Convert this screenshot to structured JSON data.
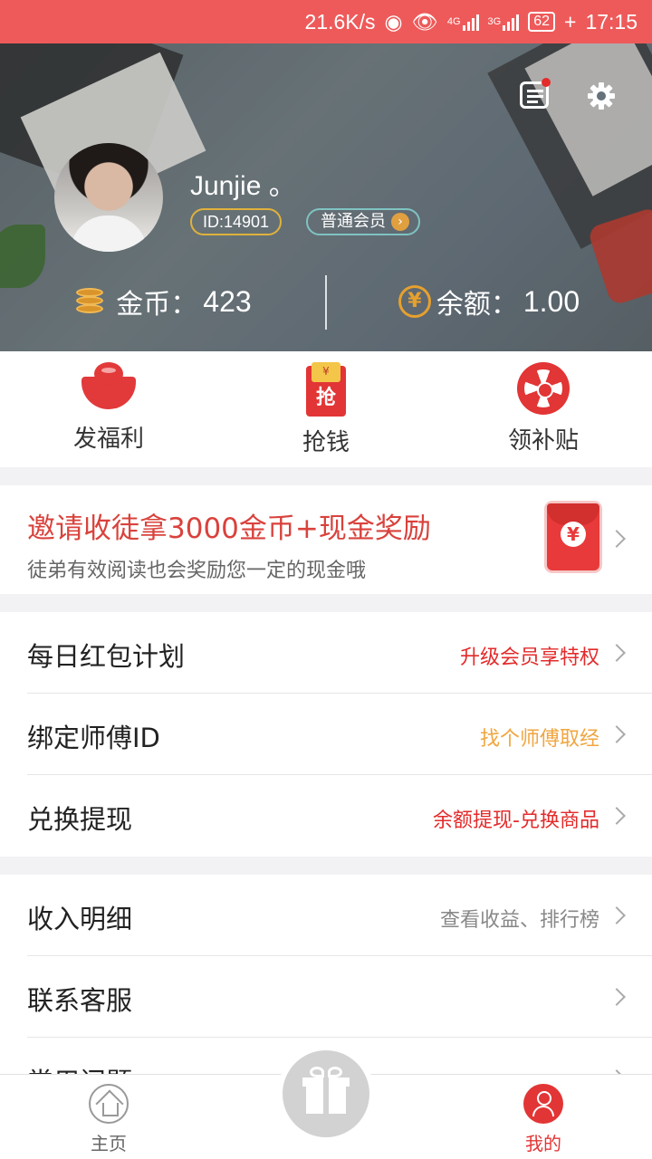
{
  "status_bar": {
    "speed": "21.6K/s",
    "battery": "62",
    "time": "17:15",
    "net1": "4G",
    "net2": "3G"
  },
  "header": {
    "username": "Junjie 。",
    "user_id": "ID:14901",
    "member_level": "普通会员",
    "coins_label": "金币：",
    "coins_value": "423",
    "balance_label": "余额：",
    "balance_value": "1.00"
  },
  "quick_actions": [
    {
      "label": "发福利",
      "icon": "red-bowl-icon"
    },
    {
      "label": "抢钱",
      "icon": "grab-money-icon",
      "icon_text": "抢",
      "icon_sub": "¥"
    },
    {
      "label": "领补贴",
      "icon": "red-wheel-icon"
    }
  ],
  "invite": {
    "title": "邀请收徒拿3000金币+现金奖励",
    "subtitle": "徒弟有效阅读也会奖励您一定的现金哦",
    "icon_text": "¥"
  },
  "menu_group1": [
    {
      "title": "每日红包计划",
      "hint": "升级会员享特权",
      "hint_color": "#e32b2b"
    },
    {
      "title": "绑定师傅ID",
      "hint": "找个师傅取经",
      "hint_color": "#f0a640"
    },
    {
      "title": "兑换提现",
      "hint": "余额提现-兑换商品",
      "hint_color": "#e32b2b"
    }
  ],
  "menu_group2": [
    {
      "title": "收入明细",
      "hint": "查看收益、排行榜",
      "hint_color": "#888888"
    },
    {
      "title": "联系客服",
      "hint": "",
      "hint_color": "#888888"
    },
    {
      "title": "常用问题",
      "hint": "",
      "hint_color": "#888888"
    }
  ],
  "tabbar": {
    "home": "主页",
    "me": "我的"
  },
  "colors": {
    "accent": "#e23535",
    "status_bar": "#ee5a5a"
  }
}
